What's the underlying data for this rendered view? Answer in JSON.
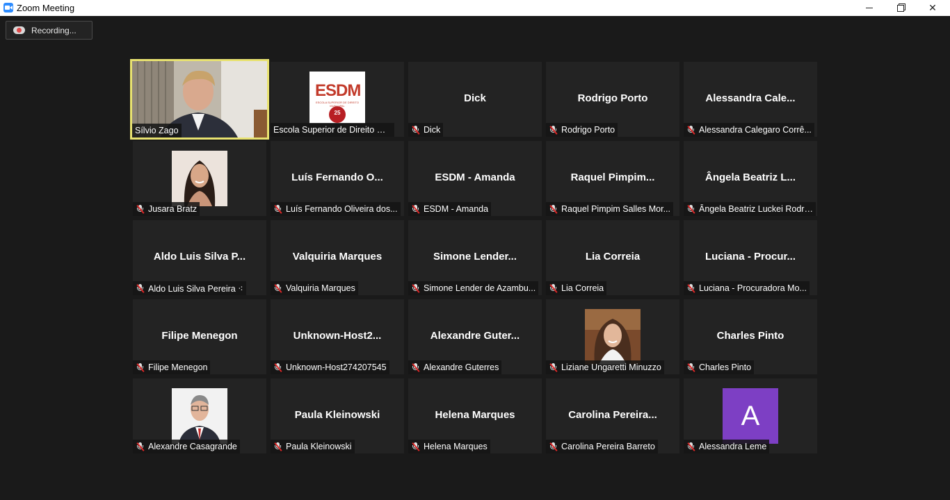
{
  "window": {
    "title": "Zoom Meeting"
  },
  "recording": {
    "label": "Recording..."
  },
  "colors": {
    "active_border": "#e8e270",
    "avatar_purple": "#7d3fc4",
    "muted_red": "#e02828",
    "tile_bg": "#232323"
  },
  "participants": [
    {
      "name": "Sílvio Zago",
      "center": "",
      "video": "video-man-suit"
    },
    {
      "name": "Escola Superior de Direito Mu...",
      "center": "",
      "video": "esdm-logo"
    },
    {
      "name": "Dick",
      "center": "Dick"
    },
    {
      "name": "Rodrigo Porto",
      "center": "Rodrigo Porto"
    },
    {
      "name": "Alessandra Calegaro Corrê...",
      "center": "Alessandra  Cale..."
    },
    {
      "name": "Jusara Bratz",
      "center": "",
      "video": "photo-woman-dark-hair"
    },
    {
      "name": "Luís Fernando Oliveira dos...",
      "center": "Luís  Fernando  O..."
    },
    {
      "name": "ESDM - Amanda",
      "center": "ESDM  -  Amanda"
    },
    {
      "name": "Raquel Pimpim Salles Mor...",
      "center": "Raquel  Pimpim..."
    },
    {
      "name": "Ângela Beatriz Luckei Rodri...",
      "center": "Ângela  Beatriz  L..."
    },
    {
      "name": "Aldo Luis Silva Pereira ⁖",
      "center": "Aldo  Luis  Silva  P..."
    },
    {
      "name": "Valquiria Marques",
      "center": "Valquiria Marques"
    },
    {
      "name": "Simone Lender de Azambu...",
      "center": "Simone  Lender..."
    },
    {
      "name": "Lia Correia",
      "center": "Lia Correia"
    },
    {
      "name": "Luciana - Procuradora Mo...",
      "center": "Luciana  -  Procur..."
    },
    {
      "name": "Filipe Menegon",
      "center": "Filipe Menegon"
    },
    {
      "name": "Unknown-Host274207545",
      "center": "Unknown-Host2..."
    },
    {
      "name": "Alexandre Guterres",
      "center": "Alexandre  Guter..."
    },
    {
      "name": "Liziane Ungaretti Minuzzo",
      "center": "",
      "video": "photo-woman-curly-hair"
    },
    {
      "name": "Charles Pinto",
      "center": "Charles Pinto"
    },
    {
      "name": "Alexandre Casagrande",
      "center": "",
      "video": "photo-man-glasses"
    },
    {
      "name": "Paula Kleinowski",
      "center": "Paula Kleinowski"
    },
    {
      "name": "Helena Marques",
      "center": "Helena Marques"
    },
    {
      "name": "Carolina Pereira Barreto",
      "center": "Carolina  Pereira..."
    },
    {
      "name": "Alessandra Leme",
      "center": "",
      "avatar_letter": "A"
    }
  ],
  "esdm": {
    "logo_text": "ESDM",
    "sub_text": "ESCOLA SUPERIOR DE DIREITO MUNICIPAL",
    "seal_text": "25"
  }
}
